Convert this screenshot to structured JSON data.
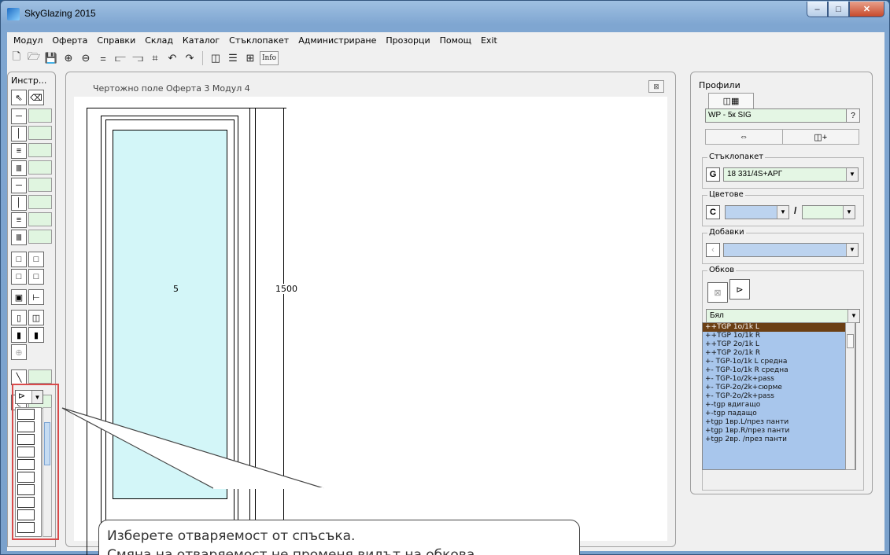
{
  "window": {
    "title": "SkyGlazing 2015"
  },
  "menu": [
    "Модул",
    "Оферта",
    "Справки",
    "Склад",
    "Каталог",
    "Стъклопакет",
    "Администриране",
    "Прозорци",
    "Помощ",
    "Exit"
  ],
  "toolbar": {
    "info_label": "Info"
  },
  "tools": {
    "title": "Инстр..."
  },
  "drawing": {
    "title": "Чертожно поле   Оферта 3   Модул 4",
    "glass_label": "5",
    "dimension_label": "1500"
  },
  "callout": {
    "line1": "Изберете отваряемост от спъсъка.",
    "line2": "Смяна на отваряемост не променя видът на обкова"
  },
  "profiles": {
    "title": "Профили",
    "profile_value": "WP - 5к SIG",
    "help_label": "?",
    "glass_group": "Стъклопакет",
    "glass_letter": "G",
    "glass_value": "18 331/4S+АРГ",
    "colors_group": "Цветове",
    "colors_letter": "C",
    "colors_sep": "/",
    "extras_group": "Добавки",
    "hardware_group": "Обков",
    "hardware_color": "Бял",
    "hardware_items": [
      "++TGP 1o/1k L",
      "++TGP 1o/1k R",
      "++TGP 2o/1k L",
      "++TGP 2o/1k R",
      "+- TGP-1o/1k L средна",
      "+- TGP-1o/1k R средна",
      "+- TGP-1o/2k+pass",
      "+- TGP-2o/2k+сюрме",
      "+- TGP-2o/2k+pass",
      "+-tgp вдигащо",
      "+-tgp падащо",
      "+tgp 1вр.L/през панти",
      "+tgp 1вр.R/през панти",
      "+tgp 2вр.  /през панти"
    ]
  },
  "colors": {
    "accent_red": "#d94b4b",
    "glass": "#d3f6f8",
    "list_blue": "#a8c6ec",
    "selected": "#6b3f14"
  }
}
